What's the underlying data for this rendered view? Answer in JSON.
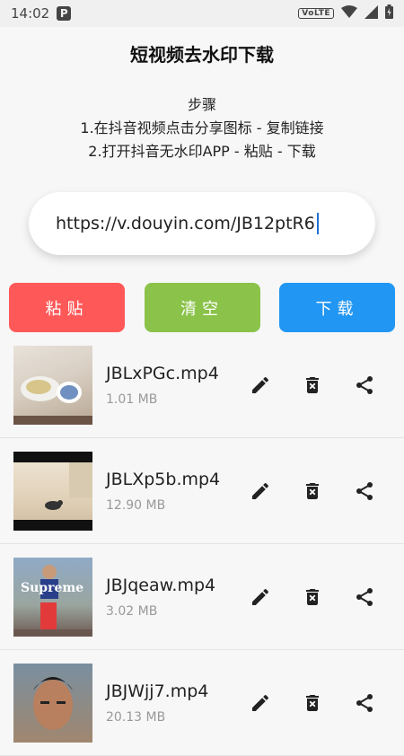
{
  "status_bar": {
    "time": "14:02",
    "app_badge": "P",
    "network": "VoLTE",
    "icons": [
      "wifi-icon",
      "signal-icon",
      "battery-icon"
    ]
  },
  "app_title": "短视频去水印下载",
  "steps": {
    "heading": "步骤",
    "step1": "1.在抖音视频点击分享图标 - 复制链接",
    "step2": "2.打开抖音无水印APP - 粘贴 - 下载"
  },
  "url_input": {
    "value": "https://v.douyin.com/JB12ptR6"
  },
  "buttons": {
    "paste": "粘贴",
    "clear": "清空",
    "download": "下载"
  },
  "colors": {
    "paste": "#ff5858",
    "clear": "#8bc34a",
    "download": "#2196f3"
  },
  "files": [
    {
      "name": "JBLxPGc.mp4",
      "size": "1.01 MB"
    },
    {
      "name": "JBLXp5b.mp4",
      "size": "12.90 MB"
    },
    {
      "name": "JBJqeaw.mp4",
      "size": "3.02 MB",
      "thumb_text": "Supreme"
    },
    {
      "name": "JBJWjj7.mp4",
      "size": "20.13 MB"
    }
  ]
}
